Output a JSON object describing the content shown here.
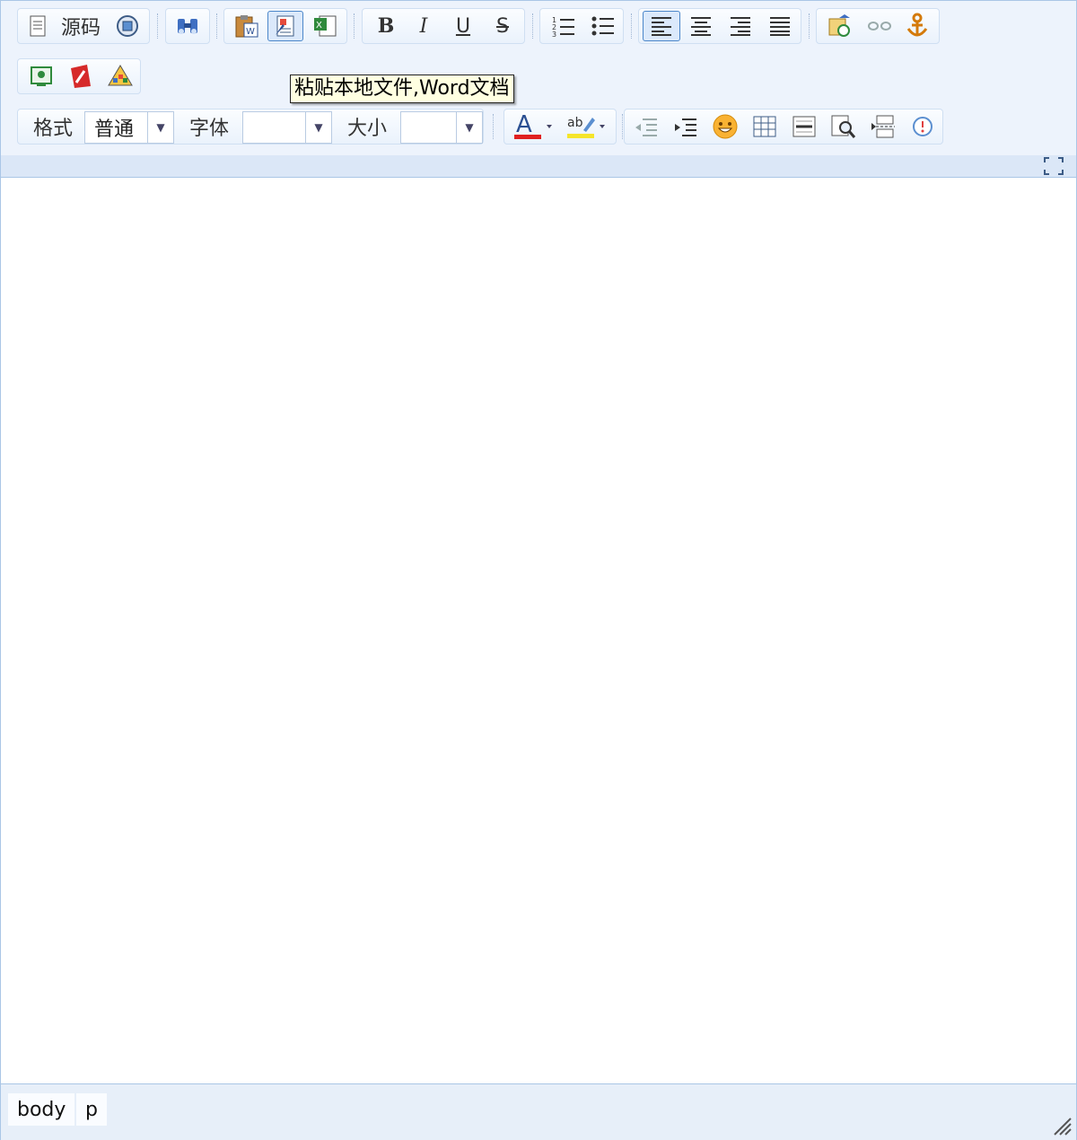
{
  "toolbar": {
    "source_label": "源码",
    "format_label": "格式",
    "format_value": "普通",
    "font_label": "字体",
    "font_value": "",
    "size_label": "大小",
    "size_value": ""
  },
  "tooltip": {
    "text": "粘贴本地文件,Word文档"
  },
  "statusbar": {
    "crumbs": [
      "body",
      "p"
    ]
  },
  "colors": {
    "font_color": "#e02020",
    "highlight_color": "#f5e52a",
    "accent": "#4b86c9"
  }
}
